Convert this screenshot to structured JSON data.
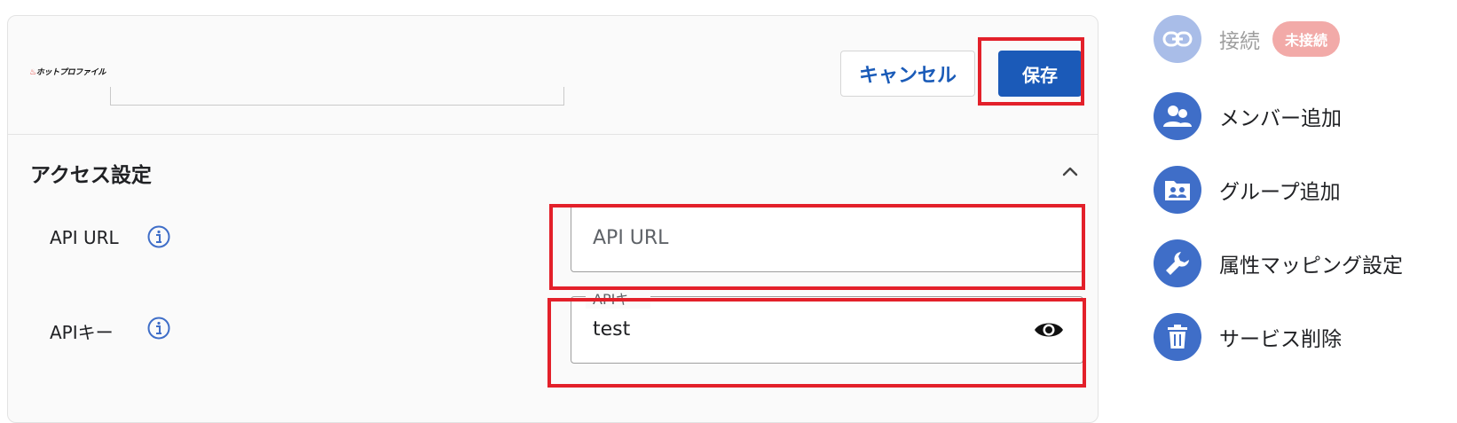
{
  "card": {
    "logo_text": "ホットプロファイル",
    "cancel_label": "キャンセル",
    "save_label": "保存"
  },
  "access": {
    "section_title": "アクセス設定",
    "api_url": {
      "label": "API URL",
      "placeholder": "API URL"
    },
    "api_key": {
      "label": "APIキー",
      "floating_label": "APIキー",
      "value": "test"
    }
  },
  "sidebar": {
    "connect": {
      "label": "接続",
      "badge": "未接続"
    },
    "items": [
      {
        "label": "メンバー追加",
        "icon": "people-icon"
      },
      {
        "label": "グループ追加",
        "icon": "group-folder-icon"
      },
      {
        "label": "属性マッピング設定",
        "icon": "wrench-icon"
      },
      {
        "label": "サービス削除",
        "icon": "trash-icon"
      }
    ]
  },
  "colors": {
    "primary": "#1b5ab8",
    "sidebar_icon": "#3f6ec8",
    "sidebar_icon_disabled": "#a9bde8",
    "highlight": "#e3202a",
    "badge": "#f2aaa8"
  }
}
